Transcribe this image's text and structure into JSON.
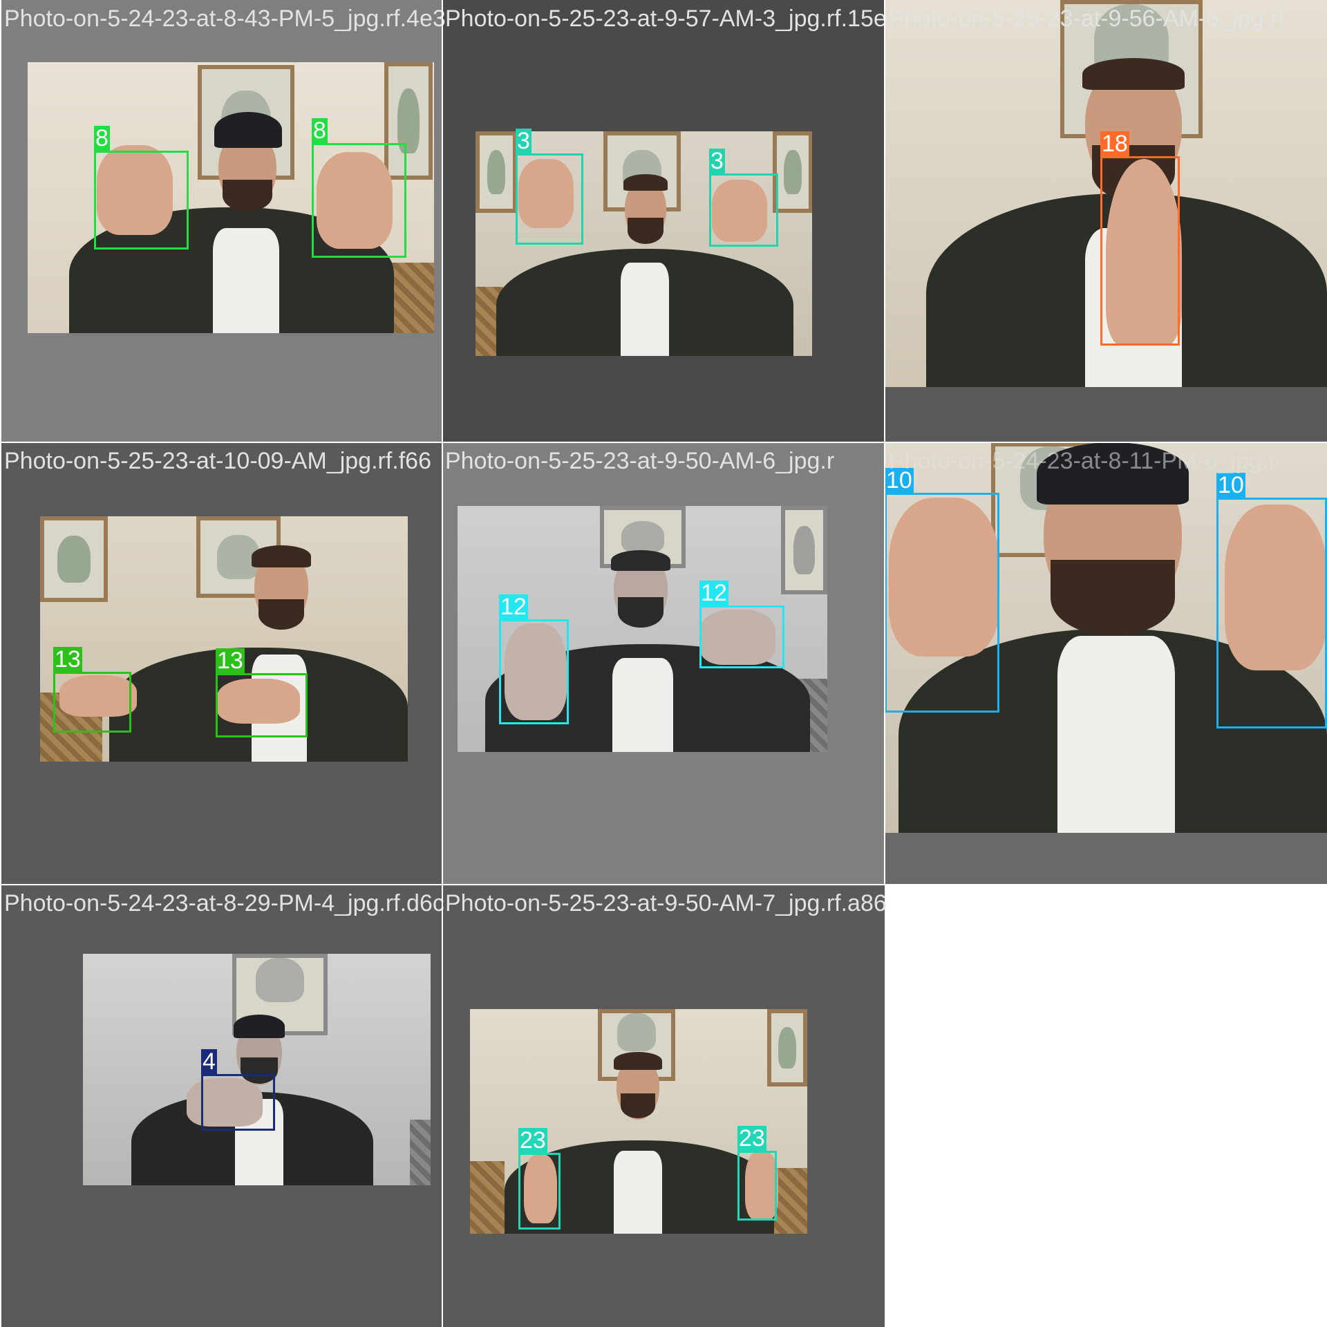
{
  "tiles": [
    {
      "id": "tile-1",
      "title": "Photo-on-5-24-23-at-8-43-PM-5_jpg.rf.4e3",
      "background": "#7f7f7f",
      "boxes": [
        {
          "label": "8",
          "color": "#22dd44"
        },
        {
          "label": "8",
          "color": "#22dd44"
        }
      ]
    },
    {
      "id": "tile-2",
      "title": "Photo-on-5-25-23-at-9-57-AM-3_jpg.rf.15e",
      "background": "#4a4a4a",
      "boxes": [
        {
          "label": "3",
          "color": "#22d3b0"
        },
        {
          "label": "3",
          "color": "#22d3b0"
        }
      ]
    },
    {
      "id": "tile-3",
      "title": "Photo-on-5-25-23-at-9-56-AM-6_jpg.rf",
      "background": "#5a5a5a",
      "boxes": [
        {
          "label": "18",
          "color": "#ff6b2b"
        }
      ]
    },
    {
      "id": "tile-4",
      "title": "Photo-on-5-25-23-at-10-09-AM_jpg.rf.f66",
      "background": "#5a5a5a",
      "boxes": [
        {
          "label": "13",
          "color": "#2ec01a"
        },
        {
          "label": "13",
          "color": "#2ec01a"
        }
      ]
    },
    {
      "id": "tile-5",
      "title": "Photo-on-5-25-23-at-9-50-AM-6_jpg.r",
      "background": "#7f7f7f",
      "boxes": [
        {
          "label": "12",
          "color": "#22e6f0"
        },
        {
          "label": "12",
          "color": "#22e6f0"
        }
      ]
    },
    {
      "id": "tile-6",
      "title": "Photo-on-5-24-23-at-8-11-PM-6_jpg.r",
      "background": "#6a6a6a",
      "boxes": [
        {
          "label": "10",
          "color": "#1ab0f0"
        },
        {
          "label": "10",
          "color": "#1ab0f0"
        }
      ]
    },
    {
      "id": "tile-7",
      "title": "Photo-on-5-24-23-at-8-29-PM-4_jpg.rf.d6c",
      "background": "#5a5a5a",
      "boxes": [
        {
          "label": "4",
          "color": "#1a2b7a"
        }
      ]
    },
    {
      "id": "tile-8",
      "title": "Photo-on-5-25-23-at-9-50-AM-7_jpg.rf.a86",
      "background": "#5a5a5a",
      "boxes": [
        {
          "label": "23",
          "color": "#22d6b8"
        },
        {
          "label": "23",
          "color": "#22d6b8"
        }
      ]
    }
  ]
}
